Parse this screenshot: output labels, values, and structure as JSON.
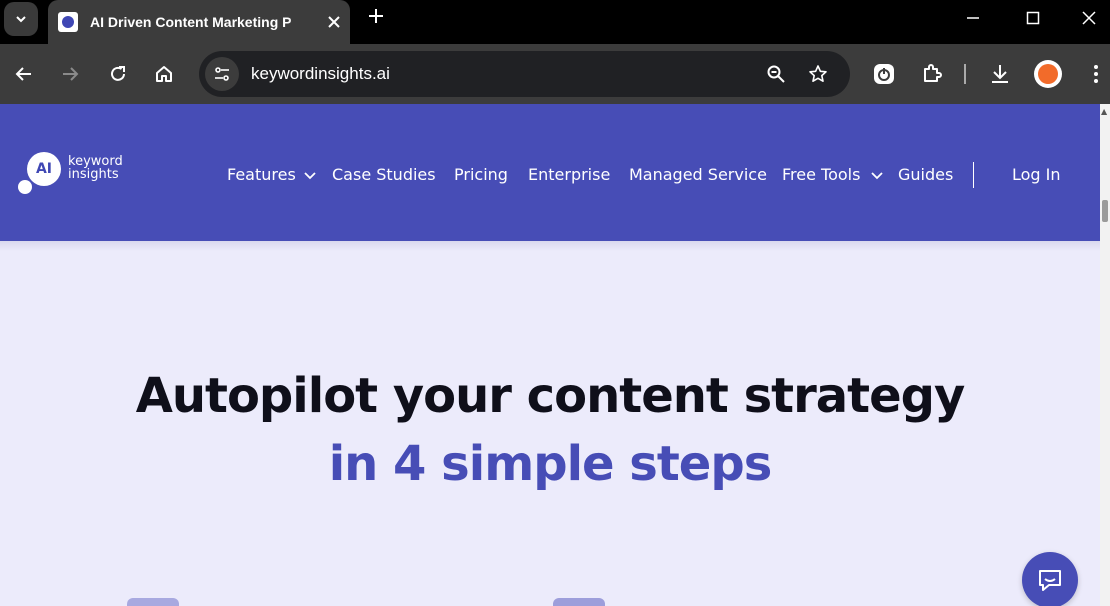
{
  "browser": {
    "tab_title": "AI Driven Content Marketing P",
    "url": "keywordinsights.ai"
  },
  "site": {
    "logo_text_1": "keyword",
    "logo_text_2": "insights",
    "logo_mark": "AI",
    "nav": [
      {
        "label": "Features",
        "dropdown": true
      },
      {
        "label": "Case Studies",
        "dropdown": false
      },
      {
        "label": "Pricing",
        "dropdown": false
      },
      {
        "label": "Enterprise",
        "dropdown": false
      },
      {
        "label": "Managed Service",
        "dropdown": false
      },
      {
        "label": "Free Tools",
        "dropdown": true
      },
      {
        "label": "Guides",
        "dropdown": false
      }
    ],
    "login_label": "Log In",
    "brand_color": "#474db6"
  },
  "hero": {
    "line1": "Autopilot your content strategy",
    "line2": "in 4 simple steps"
  },
  "icons": {
    "tab_menu": "chevron-down-icon",
    "close": "close-icon",
    "new_tab": "plus-icon",
    "back": "arrow-left-icon",
    "forward": "arrow-right-icon",
    "reload": "reload-icon",
    "home": "home-icon",
    "site_info": "tune-icon",
    "zoom": "zoom-icon",
    "bookmark": "star-icon",
    "chat": "chat-icon"
  }
}
